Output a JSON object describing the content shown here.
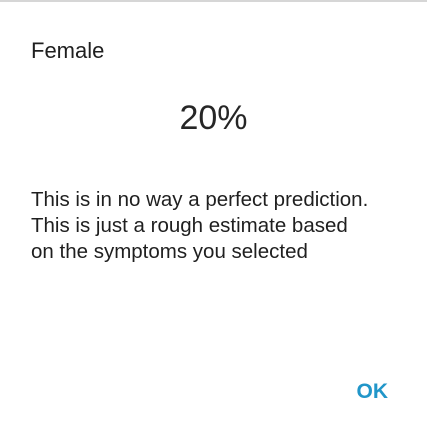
{
  "dialog": {
    "title": "Female",
    "percentage": "20%",
    "message": "This is in no way a perfect prediction.\nThis is just a rough estimate based\non the symptoms you selected",
    "ok_label": "OK"
  },
  "colors": {
    "accent": "#2196c9",
    "text": "#1f1f1f",
    "divider": "#d6d6d6",
    "background": "#ffffff"
  }
}
